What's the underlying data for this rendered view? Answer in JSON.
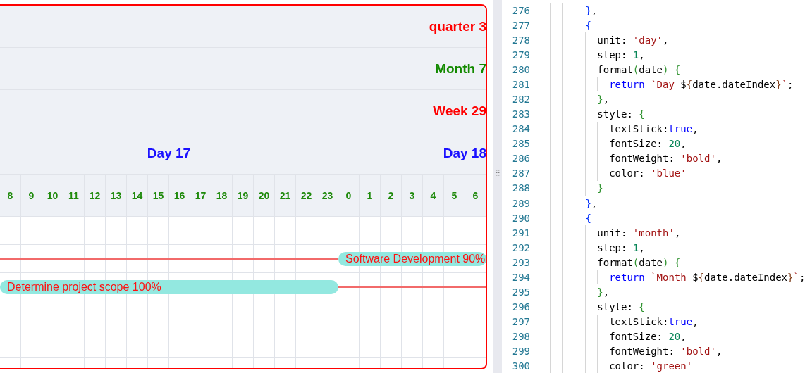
{
  "gantt": {
    "header_rows": [
      {
        "label": "quarter 3",
        "color": "#ff0000"
      },
      {
        "label": "Month 7",
        "color": "#138a00"
      },
      {
        "label": "Week 29",
        "color": "#ff0000"
      }
    ],
    "days": [
      {
        "label": "Day 17",
        "hours": [
          "8",
          "9",
          "10",
          "11",
          "12",
          "13",
          "14",
          "15",
          "16",
          "17",
          "18",
          "19",
          "20",
          "21",
          "22",
          "23"
        ]
      },
      {
        "label": "Day 18",
        "hours": [
          "0",
          "1",
          "2",
          "3",
          "4",
          "5",
          "6"
        ]
      }
    ],
    "rows": [
      {
        "segments": []
      },
      {
        "segments": [
          {
            "kind": "line"
          },
          {
            "kind": "bar",
            "label": "Software Development 90%"
          }
        ]
      },
      {
        "segments": [
          {
            "kind": "bar",
            "label": "Determine project scope 100%"
          },
          {
            "kind": "line"
          }
        ]
      },
      {
        "segments": []
      },
      {
        "segments": []
      },
      {
        "segments": []
      }
    ]
  },
  "editor": {
    "lines": [
      {
        "number": "276",
        "tokens": [
          {
            "kind": "brace1",
            "text": "        }"
          },
          {
            "kind": "plain",
            "text": ","
          }
        ]
      },
      {
        "number": "277",
        "tokens": [
          {
            "kind": "brace1",
            "text": "        {"
          }
        ]
      },
      {
        "number": "278",
        "tokens": [
          {
            "kind": "plain",
            "text": "          unit: "
          },
          {
            "kind": "string",
            "text": "'day'"
          },
          {
            "kind": "plain",
            "text": ","
          }
        ]
      },
      {
        "number": "279",
        "tokens": [
          {
            "kind": "plain",
            "text": "          step: "
          },
          {
            "kind": "number",
            "text": "1"
          },
          {
            "kind": "plain",
            "text": ","
          }
        ]
      },
      {
        "number": "280",
        "tokens": [
          {
            "kind": "plain",
            "text": "          format"
          },
          {
            "kind": "brace2",
            "text": "("
          },
          {
            "kind": "plain",
            "text": "date"
          },
          {
            "kind": "brace2",
            "text": ") {"
          }
        ]
      },
      {
        "number": "281",
        "tokens": [
          {
            "kind": "keyword",
            "text": "            return "
          },
          {
            "kind": "string",
            "text": "`Day "
          },
          {
            "kind": "plain",
            "text": "$"
          },
          {
            "kind": "brace3",
            "text": "{"
          },
          {
            "kind": "plain",
            "text": "date.dateIndex"
          },
          {
            "kind": "brace3",
            "text": "}"
          },
          {
            "kind": "string",
            "text": "`"
          },
          {
            "kind": "plain",
            "text": ";"
          }
        ]
      },
      {
        "number": "282",
        "tokens": [
          {
            "kind": "brace2",
            "text": "          }"
          },
          {
            "kind": "plain",
            "text": ","
          }
        ]
      },
      {
        "number": "283",
        "tokens": [
          {
            "kind": "plain",
            "text": "          style: "
          },
          {
            "kind": "brace2",
            "text": "{"
          }
        ]
      },
      {
        "number": "284",
        "tokens": [
          {
            "kind": "plain",
            "text": "            textStick:"
          },
          {
            "kind": "keyword",
            "text": "true"
          },
          {
            "kind": "plain",
            "text": ","
          }
        ]
      },
      {
        "number": "285",
        "tokens": [
          {
            "kind": "plain",
            "text": "            fontSize: "
          },
          {
            "kind": "number",
            "text": "20"
          },
          {
            "kind": "plain",
            "text": ","
          }
        ]
      },
      {
        "number": "286",
        "tokens": [
          {
            "kind": "plain",
            "text": "            fontWeight: "
          },
          {
            "kind": "string",
            "text": "'bold'"
          },
          {
            "kind": "plain",
            "text": ","
          }
        ]
      },
      {
        "number": "287",
        "tokens": [
          {
            "kind": "plain",
            "text": "            color: "
          },
          {
            "kind": "string",
            "text": "'blue'"
          }
        ]
      },
      {
        "number": "288",
        "tokens": [
          {
            "kind": "brace2",
            "text": "          }"
          }
        ]
      },
      {
        "number": "289",
        "tokens": [
          {
            "kind": "brace1",
            "text": "        }"
          },
          {
            "kind": "plain",
            "text": ","
          }
        ]
      },
      {
        "number": "290",
        "tokens": [
          {
            "kind": "brace1",
            "text": "        {"
          }
        ]
      },
      {
        "number": "291",
        "tokens": [
          {
            "kind": "plain",
            "text": "          unit: "
          },
          {
            "kind": "string",
            "text": "'month'"
          },
          {
            "kind": "plain",
            "text": ","
          }
        ]
      },
      {
        "number": "292",
        "tokens": [
          {
            "kind": "plain",
            "text": "          step: "
          },
          {
            "kind": "number",
            "text": "1"
          },
          {
            "kind": "plain",
            "text": ","
          }
        ]
      },
      {
        "number": "293",
        "tokens": [
          {
            "kind": "plain",
            "text": "          format"
          },
          {
            "kind": "brace2",
            "text": "("
          },
          {
            "kind": "plain",
            "text": "date"
          },
          {
            "kind": "brace2",
            "text": ") {"
          }
        ]
      },
      {
        "number": "294",
        "tokens": [
          {
            "kind": "keyword",
            "text": "            return "
          },
          {
            "kind": "string",
            "text": "`Month "
          },
          {
            "kind": "plain",
            "text": "$"
          },
          {
            "kind": "brace3",
            "text": "{"
          },
          {
            "kind": "plain",
            "text": "date.dateIndex"
          },
          {
            "kind": "brace3",
            "text": "}"
          },
          {
            "kind": "string",
            "text": "`"
          },
          {
            "kind": "plain",
            "text": ";"
          }
        ]
      },
      {
        "number": "295",
        "tokens": [
          {
            "kind": "brace2",
            "text": "          }"
          },
          {
            "kind": "plain",
            "text": ","
          }
        ]
      },
      {
        "number": "296",
        "tokens": [
          {
            "kind": "plain",
            "text": "          style: "
          },
          {
            "kind": "brace2",
            "text": "{"
          }
        ]
      },
      {
        "number": "297",
        "tokens": [
          {
            "kind": "plain",
            "text": "            textStick:"
          },
          {
            "kind": "keyword",
            "text": "true"
          },
          {
            "kind": "plain",
            "text": ","
          }
        ]
      },
      {
        "number": "298",
        "tokens": [
          {
            "kind": "plain",
            "text": "            fontSize: "
          },
          {
            "kind": "number",
            "text": "20"
          },
          {
            "kind": "plain",
            "text": ","
          }
        ]
      },
      {
        "number": "299",
        "tokens": [
          {
            "kind": "plain",
            "text": "            fontWeight: "
          },
          {
            "kind": "string",
            "text": "'bold'"
          },
          {
            "kind": "plain",
            "text": ","
          }
        ]
      },
      {
        "number": "300",
        "tokens": [
          {
            "kind": "plain",
            "text": "            color: "
          },
          {
            "kind": "string",
            "text": "'green'"
          }
        ]
      }
    ]
  }
}
